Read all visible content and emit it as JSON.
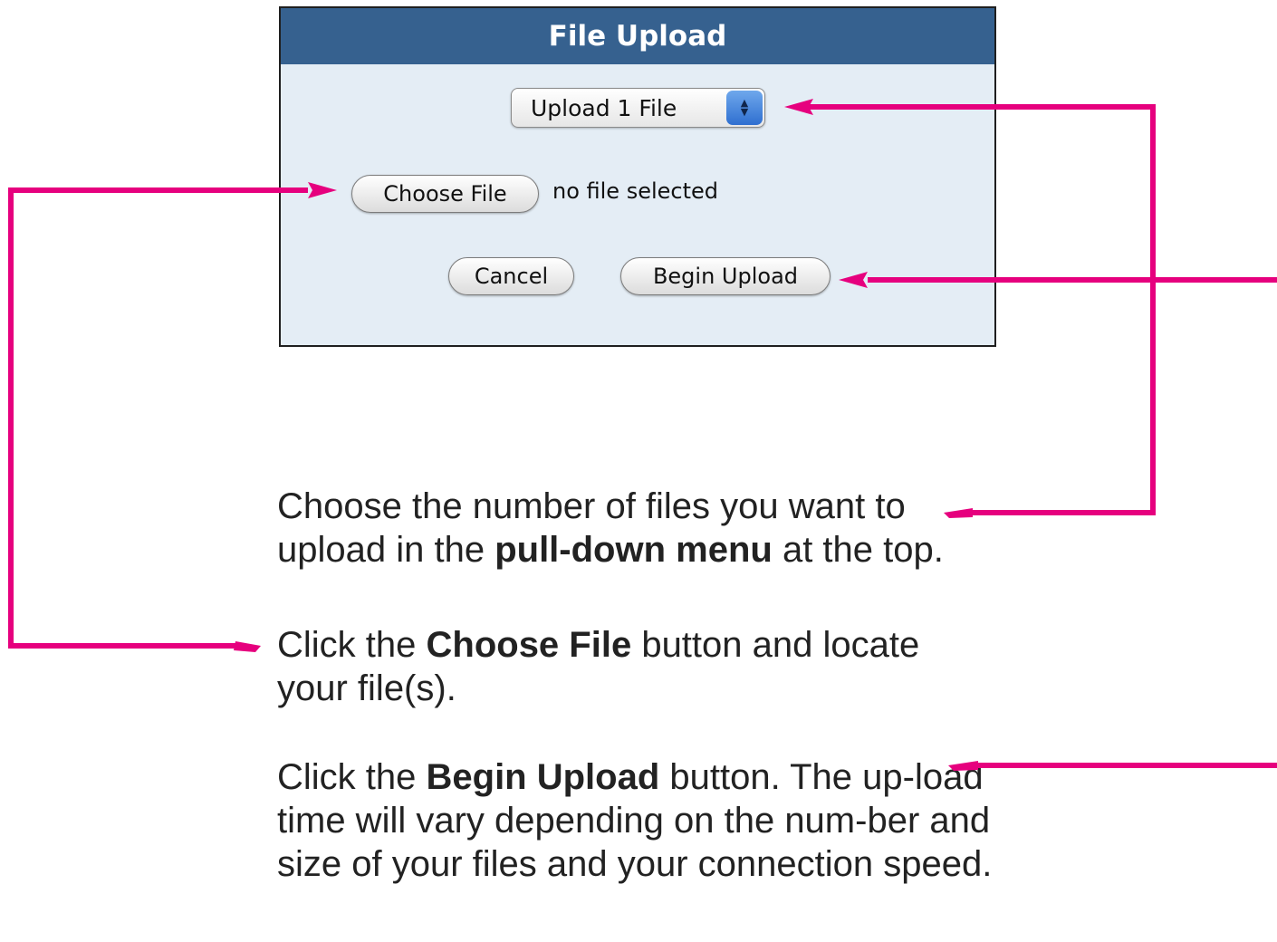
{
  "dialog": {
    "title": "File Upload",
    "upload_count_select": {
      "selected": "Upload 1 File"
    },
    "choose_file_label": "Choose File",
    "file_status": "no file selected",
    "cancel_label": "Cancel",
    "begin_upload_label": "Begin Upload"
  },
  "instructions": {
    "step1": {
      "pre": "Choose the number of files you want to upload in the ",
      "bold": "pull-down menu",
      "post": " at the top."
    },
    "step2": {
      "pre": "Click the ",
      "bold": "Choose File",
      "post": " button and locate your file(s)."
    },
    "step3": {
      "pre": "Click the ",
      "bold": "Begin Upload",
      "post": " button. The up-load time will vary depending on the num-ber and size of your files and your connection speed."
    }
  },
  "colors": {
    "titlebar": "#36618f",
    "dialog_background": "#e4edf5",
    "callout_arrows": "#e6007e"
  }
}
